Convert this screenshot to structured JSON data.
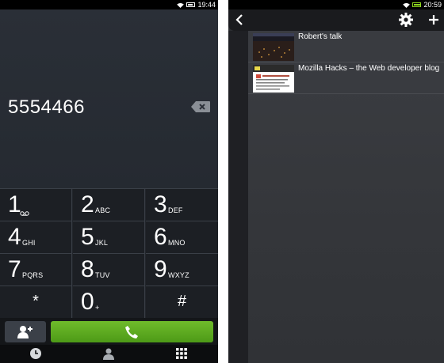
{
  "dialer": {
    "status_time": "19:44",
    "number": "5554466",
    "keys": [
      {
        "digit": "1",
        "letters": ""
      },
      {
        "digit": "2",
        "letters": "ABC"
      },
      {
        "digit": "3",
        "letters": "DEF"
      },
      {
        "digit": "4",
        "letters": "GHI"
      },
      {
        "digit": "5",
        "letters": "JKL"
      },
      {
        "digit": "6",
        "letters": "MNO"
      },
      {
        "digit": "7",
        "letters": "PQRS"
      },
      {
        "digit": "8",
        "letters": "TUV"
      },
      {
        "digit": "9",
        "letters": "WXYZ"
      },
      {
        "digit": "*",
        "letters": ""
      },
      {
        "digit": "0",
        "letters": "+"
      },
      {
        "digit": "#",
        "letters": ""
      }
    ],
    "accent_color": "#5fae22",
    "icons": {
      "backspace": "backspace-icon",
      "voicemail": "voicemail-icon",
      "add_contact": "add-contact-icon",
      "call": "phone-icon",
      "recents": "clock-icon",
      "contacts": "person-icon",
      "dialpad": "dialpad-icon"
    }
  },
  "browser": {
    "status_time": "20:59",
    "tabs": [
      {
        "title": "Robert's talk"
      },
      {
        "title": "Mozilla Hacks – the Web developer blog"
      }
    ],
    "icons": {
      "back": "back-icon",
      "settings": "gear-icon",
      "add_tab": "plus-icon"
    }
  }
}
